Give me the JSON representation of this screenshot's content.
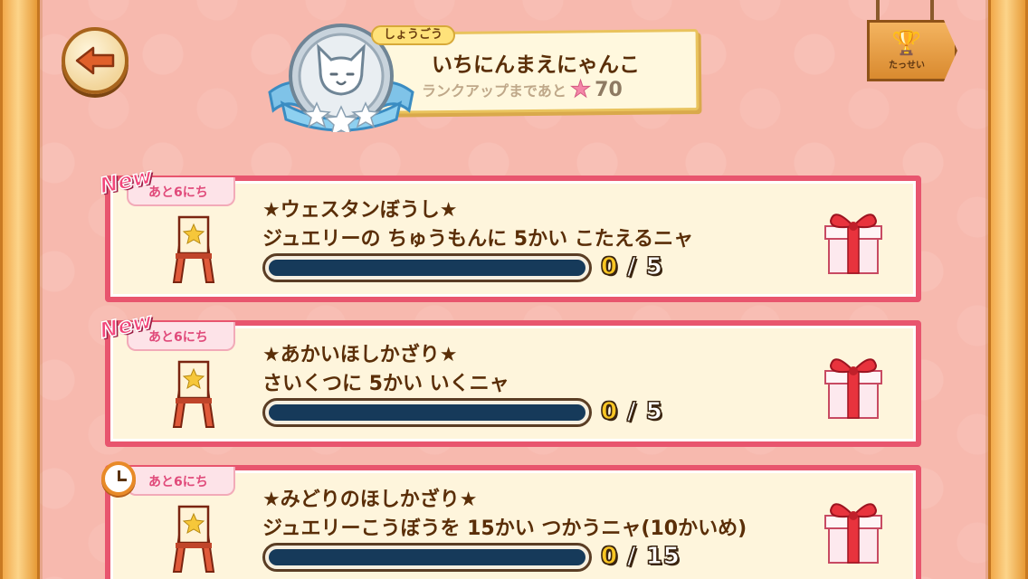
{
  "header": {
    "back_icon": "back-arrow-icon",
    "title_tag": "しょうごう",
    "title_name": "いちにんまえにゃんこ",
    "rank_next_label": "ランクアップまであと",
    "rank_next_value": "70",
    "achievement_label": "たっせい",
    "achievement_icon": "trophy-icon"
  },
  "missions": [
    {
      "is_new": true,
      "new_label": "New",
      "deadline": "あと6にち",
      "title": "★ウェスタンぼうし★",
      "description": "ジュエリーの ちゅうもんに 5かい こたえるニャ",
      "progress_current": "0",
      "progress_sep": " / ",
      "progress_total": "5",
      "progress_fraction": 0
    },
    {
      "is_new": true,
      "new_label": "New",
      "deadline": "あと6にち",
      "title": "★あかいほしかざり★",
      "description": "さいくつに 5かい いくニャ",
      "progress_current": "0",
      "progress_sep": " / ",
      "progress_total": "5",
      "progress_fraction": 0
    },
    {
      "is_new": false,
      "new_label": "",
      "deadline": "あと6にち",
      "title": "★みどりのほしかざり★",
      "description": "ジュエリーこうぼうを 15かい つかうニャ(10かいめ)",
      "progress_current": "0",
      "progress_sep": " / ",
      "progress_total": "15",
      "progress_fraction": 0
    }
  ],
  "colors": {
    "card_border": "#e8556e",
    "progress_bar": "#163a5a",
    "text_brown": "#5a2e08"
  }
}
